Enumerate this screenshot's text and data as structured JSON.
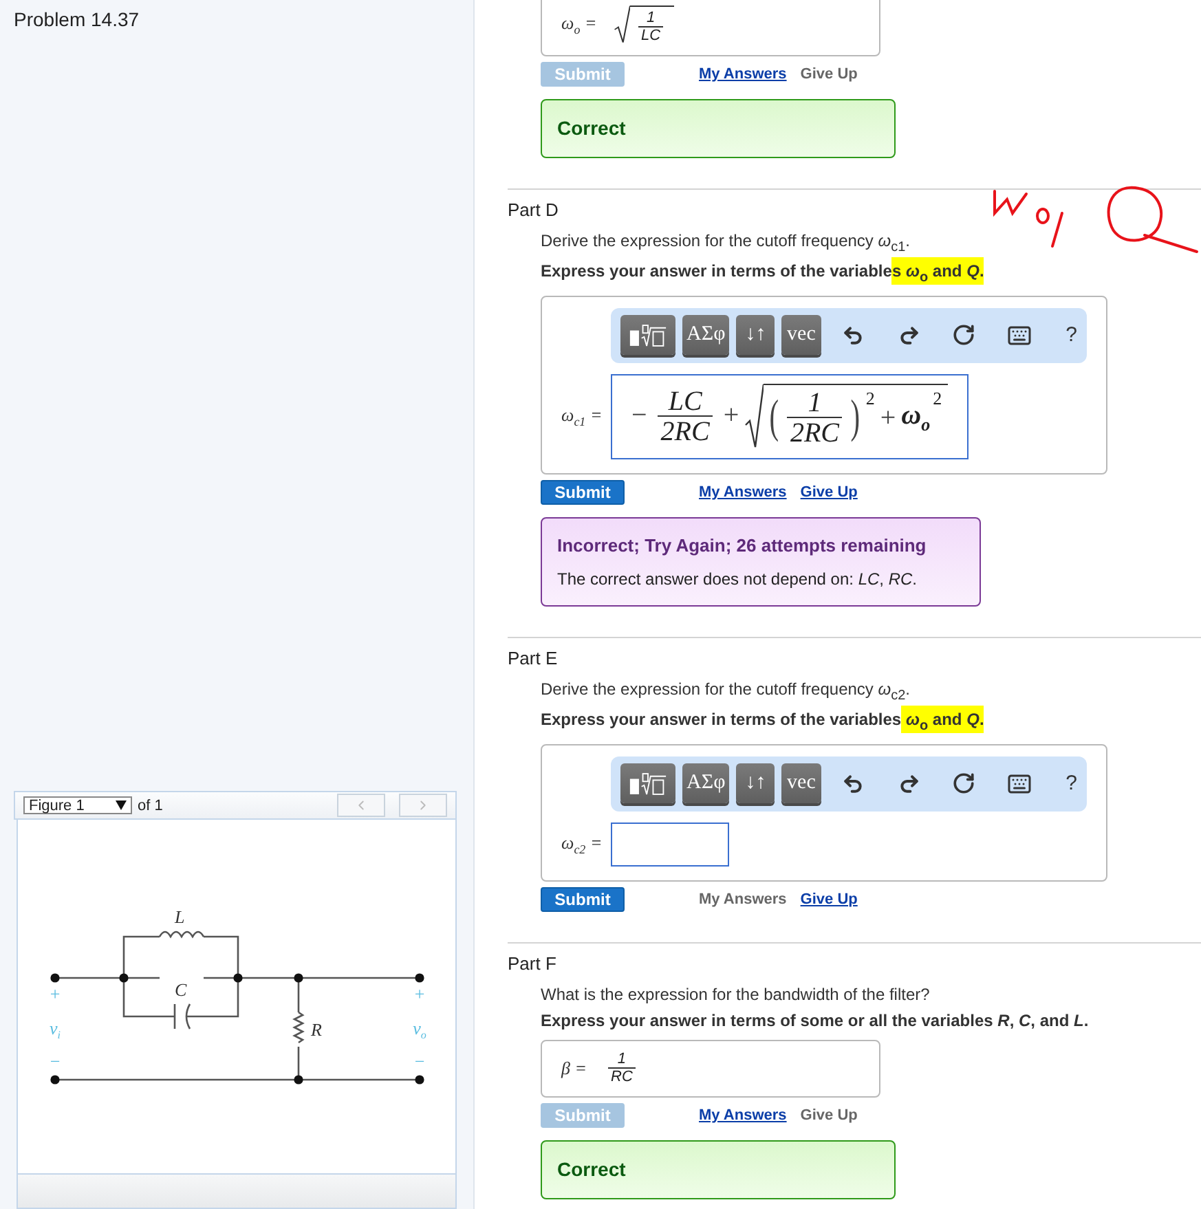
{
  "problem": {
    "title": "Problem 14.37"
  },
  "figure": {
    "selector": "Figure 1",
    "count": "of 1",
    "prev_disabled": true,
    "next_disabled": true,
    "labels": {
      "inductor": "L",
      "capacitor": "C",
      "resistor": "R"
    },
    "terminals": [
      {
        "symbol": "v",
        "subscript": "i",
        "plus": "+",
        "minus": "−"
      },
      {
        "symbol": "v",
        "subscript": "o",
        "plus": "+",
        "minus": "−"
      }
    ]
  },
  "parts": [
    {
      "answer": {
        "kind": "display",
        "label": "ω$_{o}$ =",
        "math": {
          "kind": "sqrt",
          "body": {
            "kind": "fraction",
            "num": "1",
            "den": "LC"
          }
        }
      },
      "submit": {
        "label": "Submit",
        "disabled": true
      },
      "my_answers": {
        "label": "My Answers",
        "disabled": false
      },
      "give_up": {
        "label": "Give Up",
        "disabled": true
      },
      "feedback": {
        "kind": "correct",
        "title": "Correct"
      }
    },
    {
      "title": "Part D",
      "prompt": "Derive the expression for the cutoff frequency *ω*$_{c1}$.",
      "instruction": [
        {
          "text": "Express your answer in terms of the variable",
          "highlighted": false
        },
        {
          "text": "s *ω*$_{o}$ and *Q*.",
          "highlighted": true
        }
      ],
      "answer": {
        "kind": "editor",
        "label": "ω$_{c1}$ =",
        "toolbar": [
          {
            "kind": "templates"
          },
          {
            "kind": "text",
            "label": "ΑΣφ"
          },
          {
            "kind": "text",
            "label": "↓↑"
          },
          {
            "kind": "text",
            "label": "vec"
          },
          {
            "kind": "undo"
          },
          {
            "kind": "redo"
          },
          {
            "kind": "reset"
          },
          {
            "kind": "keyboard"
          },
          {
            "kind": "help",
            "label": "?"
          }
        ],
        "value": [
          {
            "kind": "op",
            "text": "−"
          },
          {
            "kind": "fraction",
            "num": "LC",
            "den": "2RC"
          },
          {
            "kind": "op",
            "text": "+"
          },
          {
            "kind": "sqrt",
            "body": [
              {
                "kind": "paren",
                "open": "(",
                "close": ")",
                "exponent": "2",
                "body": {
                  "kind": "fraction",
                  "num": "1",
                  "den": "2RC"
                }
              },
              {
                "kind": "op",
                "text": "+"
              },
              {
                "kind": "symbol",
                "text": "ω$_{o}$",
                "exponent": "2"
              }
            ]
          }
        ]
      },
      "submit": {
        "label": "Submit",
        "disabled": false
      },
      "my_answers": {
        "label": "My Answers",
        "disabled": false
      },
      "give_up": {
        "label": "Give Up",
        "disabled": false
      },
      "feedback": {
        "kind": "incorrect",
        "title": "Incorrect; Try Again; 26 attempts remaining",
        "message": "The correct answer does not depend on: *LC*, *RC*."
      }
    },
    {
      "title": "Part E",
      "prompt": "Derive the expression for the cutoff frequency *ω*$_{c2}$.",
      "instruction": [
        {
          "text": "Express your answer in terms of the variables",
          "highlighted": false
        },
        {
          "text": " *ω*$_{o}$ and *Q*.",
          "highlighted": true
        }
      ],
      "answer": {
        "kind": "editor",
        "label": "ω$_{c2}$ =",
        "toolbar": [
          {
            "kind": "templates"
          },
          {
            "kind": "text",
            "label": "ΑΣφ"
          },
          {
            "kind": "text",
            "label": "↓↑"
          },
          {
            "kind": "text",
            "label": "vec"
          },
          {
            "kind": "undo"
          },
          {
            "kind": "redo"
          },
          {
            "kind": "reset"
          },
          {
            "kind": "keyboard"
          },
          {
            "kind": "help",
            "label": "?"
          }
        ]
      },
      "submit": {
        "label": "Submit",
        "disabled": false
      },
      "my_answers": {
        "label": "My Answers",
        "disabled": true
      },
      "give_up": {
        "label": "Give Up",
        "disabled": false
      }
    },
    {
      "title": "Part F",
      "prompt": "What is the expression for the bandwidth of the filter?",
      "instruction": [
        {
          "text": "Express your answer in terms of some or all the variables *R*, *C*, and *L*.",
          "highlighted": false
        }
      ],
      "answer": {
        "kind": "display",
        "label": "β =",
        "math": {
          "kind": "fraction",
          "num": "1",
          "den": "RC"
        }
      },
      "submit": {
        "label": "Submit",
        "disabled": true
      },
      "my_answers": {
        "label": "My Answers",
        "disabled": false
      },
      "give_up": {
        "label": "Give Up",
        "disabled": true
      },
      "feedback": {
        "kind": "correct",
        "title": "Correct"
      }
    }
  ]
}
